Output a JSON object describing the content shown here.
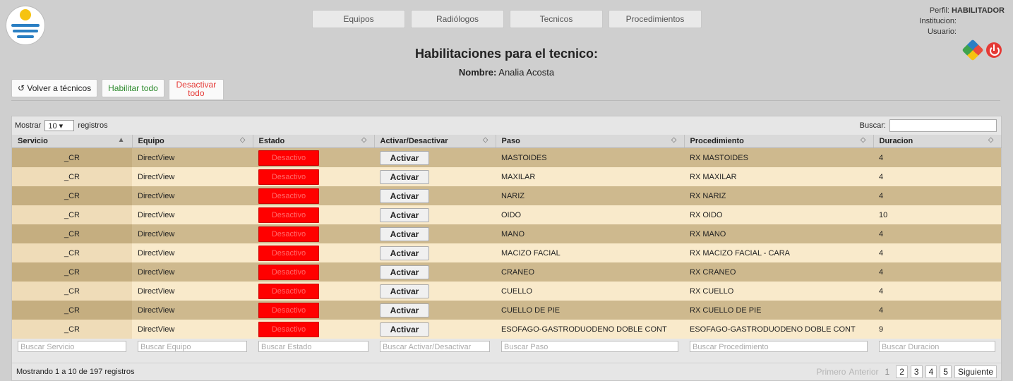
{
  "nav": [
    "Equipos",
    "Radiólogos",
    "Tecnicos",
    "Procedimientos"
  ],
  "profile": {
    "perfil_label": "Perfil:",
    "perfil_value": "HABILITADOR",
    "institucion_label": "Institucion:",
    "usuario_label": "Usuario:"
  },
  "header": {
    "title": "Habilitaciones para el tecnico:",
    "nombre_label": "Nombre:",
    "nombre_value": "Analia Acosta"
  },
  "actions": {
    "volver": "Volver a técnicos",
    "habilitar": "Habilitar todo",
    "desactivar": "Desactivar todo"
  },
  "table_controls": {
    "show_prefix": "Mostrar",
    "show_value": "10",
    "show_suffix": "registros",
    "search_label": "Buscar:"
  },
  "columns": [
    "Servicio",
    "Equipo",
    "Estado",
    "Activar/Desactivar",
    "Paso",
    "Procedimiento",
    "Duracion"
  ],
  "rows": [
    {
      "servicio": "_CR",
      "equipo": "DirectView",
      "estado": "Desactivo",
      "accion": "Activar",
      "paso": "MASTOIDES",
      "procedimiento": "RX MASTOIDES",
      "duracion": "4"
    },
    {
      "servicio": "_CR",
      "equipo": "DirectView",
      "estado": "Desactivo",
      "accion": "Activar",
      "paso": "MAXILAR",
      "procedimiento": "RX MAXILAR",
      "duracion": "4"
    },
    {
      "servicio": "_CR",
      "equipo": "DirectView",
      "estado": "Desactivo",
      "accion": "Activar",
      "paso": "NARIZ",
      "procedimiento": "RX NARIZ",
      "duracion": "4"
    },
    {
      "servicio": "_CR",
      "equipo": "DirectView",
      "estado": "Desactivo",
      "accion": "Activar",
      "paso": "OIDO",
      "procedimiento": "RX OIDO",
      "duracion": "10"
    },
    {
      "servicio": "_CR",
      "equipo": "DirectView",
      "estado": "Desactivo",
      "accion": "Activar",
      "paso": "MANO",
      "procedimiento": "RX MANO",
      "duracion": "4"
    },
    {
      "servicio": "_CR",
      "equipo": "DirectView",
      "estado": "Desactivo",
      "accion": "Activar",
      "paso": "MACIZO FACIAL",
      "procedimiento": "RX MACIZO FACIAL - CARA",
      "duracion": "4"
    },
    {
      "servicio": "_CR",
      "equipo": "DirectView",
      "estado": "Desactivo",
      "accion": "Activar",
      "paso": "CRANEO",
      "procedimiento": "RX CRANEO",
      "duracion": "4"
    },
    {
      "servicio": "_CR",
      "equipo": "DirectView",
      "estado": "Desactivo",
      "accion": "Activar",
      "paso": "CUELLO",
      "procedimiento": "RX CUELLO",
      "duracion": "4"
    },
    {
      "servicio": "_CR",
      "equipo": "DirectView",
      "estado": "Desactivo",
      "accion": "Activar",
      "paso": "CUELLO DE PIE",
      "procedimiento": "RX CUELLO DE PIE",
      "duracion": "4"
    },
    {
      "servicio": "_CR",
      "equipo": "DirectView",
      "estado": "Desactivo",
      "accion": "Activar",
      "paso": "ESOFAGO-GASTRODUODENO DOBLE CONT",
      "procedimiento": "ESOFAGO-GASTRODUODENO DOBLE CONT",
      "duracion": "9"
    }
  ],
  "filters": [
    "Buscar Servicio",
    "Buscar Equipo",
    "Buscar Estado",
    "Buscar Activar/Desactivar",
    "Buscar Paso",
    "Buscar Procedimiento",
    "Buscar Duracion"
  ],
  "footer": {
    "info": "Mostrando 1 a 10 de 197 registros",
    "first": "Primero",
    "prev": "Anterior",
    "pages": [
      "1",
      "2",
      "3",
      "4",
      "5"
    ],
    "current_page": "1",
    "next": "Siguiente"
  },
  "colors": {
    "row_odd": "#ceb98e",
    "row_even": "#f9eacb",
    "desactivo_bg": "#ff0000"
  }
}
